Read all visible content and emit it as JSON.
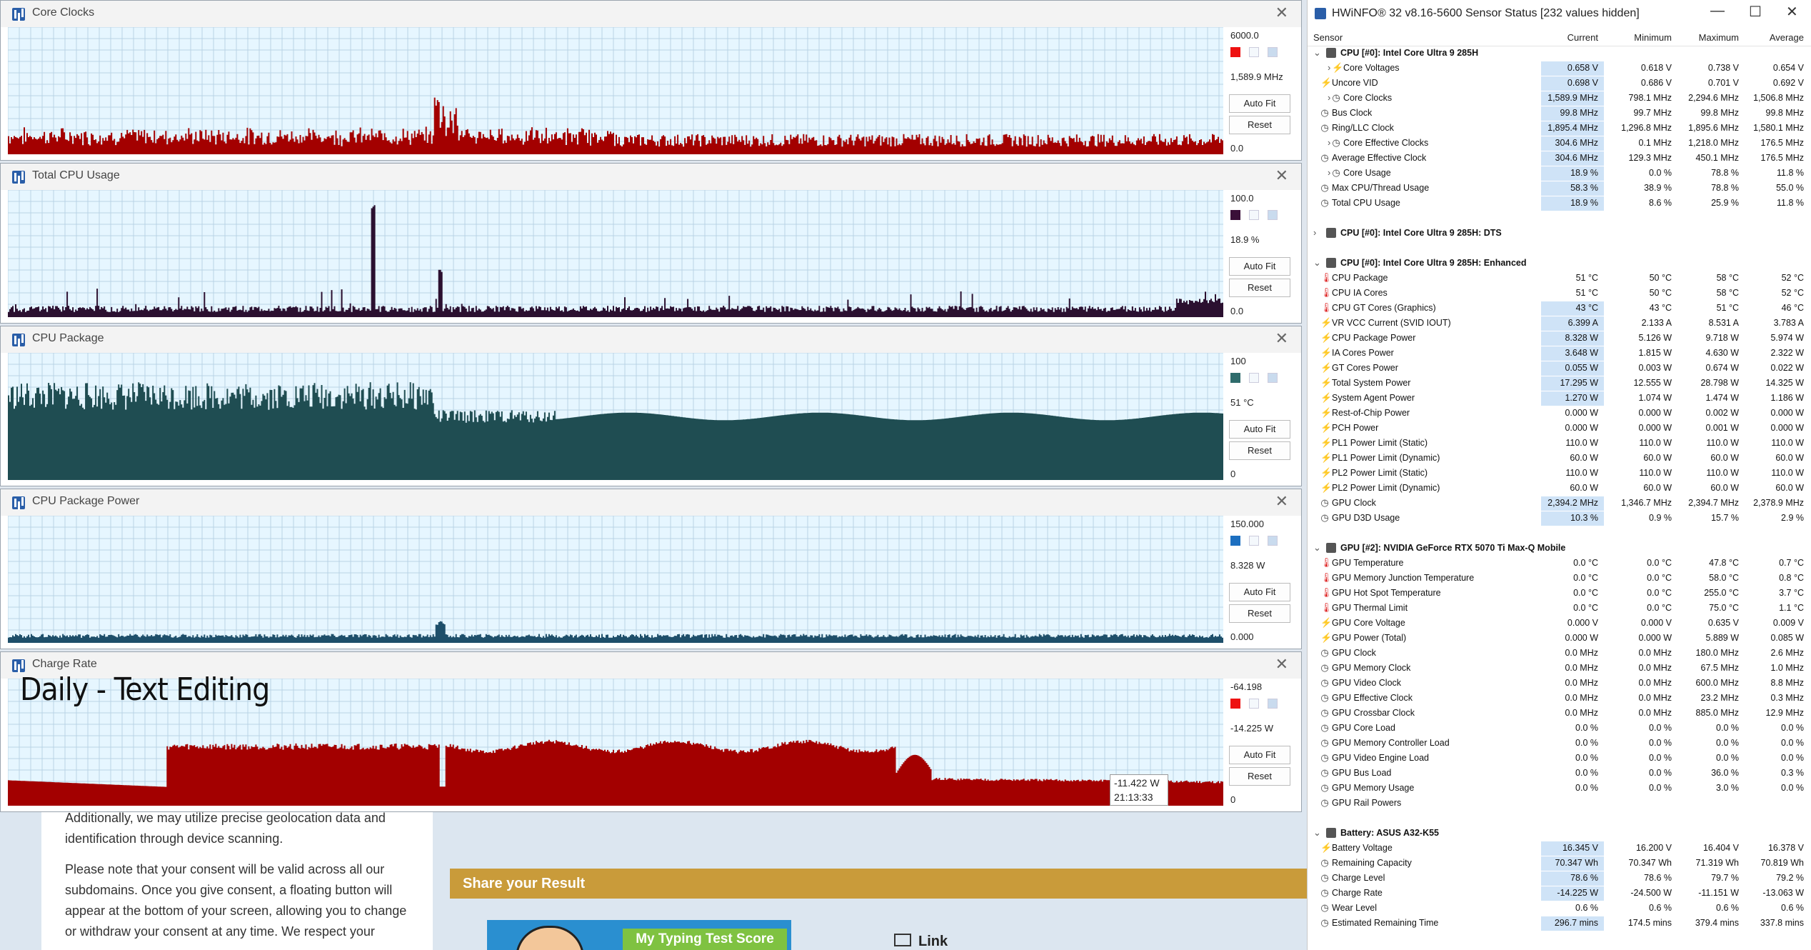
{
  "graphs": [
    {
      "title": "Core Clocks",
      "max": "6000.0",
      "current": "1,589.9 MHz",
      "min": "0.0",
      "color": "#a30000",
      "swatch": "#ee1111",
      "fill_fraction": 0.17,
      "spike_fraction": 0.56,
      "pattern": "clock"
    },
    {
      "title": "Total CPU Usage",
      "max": "100.0",
      "current": "18.9 %",
      "min": "0.0",
      "color": "#2b1030",
      "swatch": "#3a0f38",
      "fill_fraction": 0.06,
      "spike_fraction": 0.85,
      "pattern": "usage"
    },
    {
      "title": "CPU Package",
      "max": "100",
      "current": "51 °C",
      "min": "0",
      "color": "#1f4d52",
      "swatch": "#2f6c6c",
      "fill_fraction": 0.52,
      "spike_fraction": 0.8,
      "pattern": "temp"
    },
    {
      "title": "CPU Package Power",
      "max": "150.000",
      "current": "8.328 W",
      "min": "0.000",
      "color": "#1e4f6a",
      "swatch": "#1d6fc0",
      "fill_fraction": 0.05,
      "spike_fraction": 0.16,
      "pattern": "power"
    },
    {
      "title": "Charge Rate",
      "max": "-64.198",
      "current": "-14.225 W",
      "min": "0",
      "color": "#a30000",
      "swatch": "#ee1111",
      "fill_fraction": 0.24,
      "spike_fraction": 0.52,
      "pattern": "charge"
    }
  ],
  "buttons": {
    "autofit": "Auto Fit",
    "reset": "Reset"
  },
  "overlay_title": "Daily - Text Editing",
  "tooltip": {
    "value": "-11.422 W",
    "time": "21:13:33"
  },
  "background_page": {
    "p1": "Additionally, we may utilize precise geolocation data and identification through device scanning.",
    "p2": "Please note that your consent will be valid across all our subdomains. Once you give consent, a floating button will appear at the bottom of your screen, allowing you to change or withdraw your consent at any time. We respect your",
    "share_title": "Share your Result",
    "badge": "My Typing Test Score",
    "link": "Link"
  },
  "hwinfo": {
    "title": "HWiNFO® 32 v8.16-5600 Sensor Status [232 values hidden]",
    "columns": [
      "Sensor",
      "Current",
      "Minimum",
      "Maximum",
      "Average"
    ],
    "rows": [
      {
        "type": "hdr",
        "label": "CPU [#0]: Intel Core Ultra 9 285H",
        "exp": "⌄"
      },
      {
        "type": "row",
        "icon": "bolt",
        "sub": true,
        "exp": "›",
        "label": "Core Voltages",
        "cur": "0.658 V",
        "min": "0.618 V",
        "max": "0.738 V",
        "avg": "0.654 V",
        "hl": true
      },
      {
        "type": "row",
        "icon": "bolt",
        "label": "Uncore VID",
        "cur": "0.698 V",
        "min": "0.686 V",
        "max": "0.701 V",
        "avg": "0.692 V",
        "hl": true
      },
      {
        "type": "row",
        "icon": "clock",
        "sub": true,
        "exp": "›",
        "label": "Core Clocks",
        "cur": "1,589.9 MHz",
        "min": "798.1 MHz",
        "max": "2,294.6 MHz",
        "avg": "1,506.8 MHz",
        "hl": true
      },
      {
        "type": "row",
        "icon": "clock",
        "label": "Bus Clock",
        "cur": "99.8 MHz",
        "min": "99.7 MHz",
        "max": "99.8 MHz",
        "avg": "99.8 MHz",
        "hl": true
      },
      {
        "type": "row",
        "icon": "clock",
        "label": "Ring/LLC Clock",
        "cur": "1,895.4 MHz",
        "min": "1,296.8 MHz",
        "max": "1,895.6 MHz",
        "avg": "1,580.1 MHz",
        "hl": true
      },
      {
        "type": "row",
        "icon": "clock",
        "sub": true,
        "exp": "›",
        "label": "Core Effective Clocks",
        "cur": "304.6 MHz",
        "min": "0.1 MHz",
        "max": "1,218.0 MHz",
        "avg": "176.5 MHz",
        "hl": true
      },
      {
        "type": "row",
        "icon": "clock",
        "label": "Average Effective Clock",
        "cur": "304.6 MHz",
        "min": "129.3 MHz",
        "max": "450.1 MHz",
        "avg": "176.5 MHz",
        "hl": true
      },
      {
        "type": "row",
        "icon": "clock",
        "sub": true,
        "exp": "›",
        "label": "Core Usage",
        "cur": "18.9 %",
        "min": "0.0 %",
        "max": "78.8 %",
        "avg": "11.8 %",
        "hl": true
      },
      {
        "type": "row",
        "icon": "clock",
        "label": "Max CPU/Thread Usage",
        "cur": "58.3 %",
        "min": "38.9 %",
        "max": "78.8 %",
        "avg": "55.0 %",
        "hl": true
      },
      {
        "type": "row",
        "icon": "clock",
        "label": "Total CPU Usage",
        "cur": "18.9 %",
        "min": "8.6 %",
        "max": "25.9 %",
        "avg": "11.8 %",
        "hl": true
      },
      {
        "type": "gap"
      },
      {
        "type": "hdr",
        "label": "CPU [#0]: Intel Core Ultra 9 285H: DTS",
        "exp": "›"
      },
      {
        "type": "gap"
      },
      {
        "type": "hdr",
        "label": "CPU [#0]: Intel Core Ultra 9 285H: Enhanced",
        "exp": "⌄"
      },
      {
        "type": "row",
        "icon": "therm",
        "label": "CPU Package",
        "cur": "51 °C",
        "min": "50 °C",
        "max": "58 °C",
        "avg": "52 °C"
      },
      {
        "type": "row",
        "icon": "therm",
        "label": "CPU IA Cores",
        "cur": "51 °C",
        "min": "50 °C",
        "max": "58 °C",
        "avg": "52 °C"
      },
      {
        "type": "row",
        "icon": "therm",
        "label": "CPU GT Cores (Graphics)",
        "cur": "43 °C",
        "min": "43 °C",
        "max": "51 °C",
        "avg": "46 °C",
        "hl": true
      },
      {
        "type": "row",
        "icon": "bolt",
        "label": "VR VCC Current (SVID IOUT)",
        "cur": "6.399 A",
        "min": "2.133 A",
        "max": "8.531 A",
        "avg": "3.783 A",
        "hl": true
      },
      {
        "type": "row",
        "icon": "bolt",
        "label": "CPU Package Power",
        "cur": "8.328 W",
        "min": "5.126 W",
        "max": "9.718 W",
        "avg": "5.974 W",
        "hl": true
      },
      {
        "type": "row",
        "icon": "bolt",
        "label": "IA Cores Power",
        "cur": "3.648 W",
        "min": "1.815 W",
        "max": "4.630 W",
        "avg": "2.322 W",
        "hl": true
      },
      {
        "type": "row",
        "icon": "bolt",
        "label": "GT Cores Power",
        "cur": "0.055 W",
        "min": "0.003 W",
        "max": "0.674 W",
        "avg": "0.022 W",
        "hl": true
      },
      {
        "type": "row",
        "icon": "bolt",
        "label": "Total System Power",
        "cur": "17.295 W",
        "min": "12.555 W",
        "max": "28.798 W",
        "avg": "14.325 W",
        "hl": true
      },
      {
        "type": "row",
        "icon": "bolt",
        "label": "System Agent Power",
        "cur": "1.270 W",
        "min": "1.074 W",
        "max": "1.474 W",
        "avg": "1.186 W",
        "hl": true
      },
      {
        "type": "row",
        "icon": "bolt",
        "label": "Rest-of-Chip Power",
        "cur": "0.000 W",
        "min": "0.000 W",
        "max": "0.002 W",
        "avg": "0.000 W"
      },
      {
        "type": "row",
        "icon": "bolt",
        "label": "PCH Power",
        "cur": "0.000 W",
        "min": "0.000 W",
        "max": "0.001 W",
        "avg": "0.000 W"
      },
      {
        "type": "row",
        "icon": "bolt",
        "label": "PL1 Power Limit (Static)",
        "cur": "110.0 W",
        "min": "110.0 W",
        "max": "110.0 W",
        "avg": "110.0 W"
      },
      {
        "type": "row",
        "icon": "bolt",
        "label": "PL1 Power Limit (Dynamic)",
        "cur": "60.0 W",
        "min": "60.0 W",
        "max": "60.0 W",
        "avg": "60.0 W"
      },
      {
        "type": "row",
        "icon": "bolt",
        "label": "PL2 Power Limit (Static)",
        "cur": "110.0 W",
        "min": "110.0 W",
        "max": "110.0 W",
        "avg": "110.0 W"
      },
      {
        "type": "row",
        "icon": "bolt",
        "label": "PL2 Power Limit (Dynamic)",
        "cur": "60.0 W",
        "min": "60.0 W",
        "max": "60.0 W",
        "avg": "60.0 W"
      },
      {
        "type": "row",
        "icon": "clock",
        "label": "GPU Clock",
        "cur": "2,394.2 MHz",
        "min": "1,346.7 MHz",
        "max": "2,394.7 MHz",
        "avg": "2,378.9 MHz",
        "hl": true
      },
      {
        "type": "row",
        "icon": "clock",
        "label": "GPU D3D Usage",
        "cur": "10.3 %",
        "min": "0.9 %",
        "max": "15.7 %",
        "avg": "2.9 %",
        "hl": true
      },
      {
        "type": "gap"
      },
      {
        "type": "hdr",
        "label": "GPU [#2]: NVIDIA  GeForce RTX 5070 Ti Max-Q Mobile",
        "exp": "⌄"
      },
      {
        "type": "row",
        "icon": "therm",
        "label": "GPU Temperature",
        "cur": "0.0 °C",
        "min": "0.0 °C",
        "max": "47.8 °C",
        "avg": "0.7 °C"
      },
      {
        "type": "row",
        "icon": "therm",
        "label": "GPU Memory Junction Temperature",
        "cur": "0.0 °C",
        "min": "0.0 °C",
        "max": "58.0 °C",
        "avg": "0.8 °C"
      },
      {
        "type": "row",
        "icon": "therm",
        "label": "GPU Hot Spot Temperature",
        "cur": "0.0 °C",
        "min": "0.0 °C",
        "max": "255.0 °C",
        "avg": "3.7 °C"
      },
      {
        "type": "row",
        "icon": "therm",
        "label": "GPU Thermal Limit",
        "cur": "0.0 °C",
        "min": "0.0 °C",
        "max": "75.0 °C",
        "avg": "1.1 °C"
      },
      {
        "type": "row",
        "icon": "bolt",
        "label": "GPU Core Voltage",
        "cur": "0.000 V",
        "min": "0.000 V",
        "max": "0.635 V",
        "avg": "0.009 V"
      },
      {
        "type": "row",
        "icon": "bolt",
        "label": "GPU Power (Total)",
        "cur": "0.000 W",
        "min": "0.000 W",
        "max": "5.889 W",
        "avg": "0.085 W"
      },
      {
        "type": "row",
        "icon": "clock",
        "label": "GPU Clock",
        "cur": "0.0 MHz",
        "min": "0.0 MHz",
        "max": "180.0 MHz",
        "avg": "2.6 MHz"
      },
      {
        "type": "row",
        "icon": "clock",
        "label": "GPU Memory Clock",
        "cur": "0.0 MHz",
        "min": "0.0 MHz",
        "max": "67.5 MHz",
        "avg": "1.0 MHz"
      },
      {
        "type": "row",
        "icon": "clock",
        "label": "GPU Video Clock",
        "cur": "0.0 MHz",
        "min": "0.0 MHz",
        "max": "600.0 MHz",
        "avg": "8.8 MHz"
      },
      {
        "type": "row",
        "icon": "clock",
        "label": "GPU Effective Clock",
        "cur": "0.0 MHz",
        "min": "0.0 MHz",
        "max": "23.2 MHz",
        "avg": "0.3 MHz"
      },
      {
        "type": "row",
        "icon": "clock",
        "label": "GPU Crossbar Clock",
        "cur": "0.0 MHz",
        "min": "0.0 MHz",
        "max": "885.0 MHz",
        "avg": "12.9 MHz"
      },
      {
        "type": "row",
        "icon": "clock",
        "label": "GPU Core Load",
        "cur": "0.0 %",
        "min": "0.0 %",
        "max": "0.0 %",
        "avg": "0.0 %"
      },
      {
        "type": "row",
        "icon": "clock",
        "label": "GPU Memory Controller Load",
        "cur": "0.0 %",
        "min": "0.0 %",
        "max": "0.0 %",
        "avg": "0.0 %"
      },
      {
        "type": "row",
        "icon": "clock",
        "label": "GPU Video Engine Load",
        "cur": "0.0 %",
        "min": "0.0 %",
        "max": "0.0 %",
        "avg": "0.0 %"
      },
      {
        "type": "row",
        "icon": "clock",
        "label": "GPU Bus Load",
        "cur": "0.0 %",
        "min": "0.0 %",
        "max": "36.0 %",
        "avg": "0.3 %"
      },
      {
        "type": "row",
        "icon": "clock",
        "label": "GPU Memory Usage",
        "cur": "0.0 %",
        "min": "0.0 %",
        "max": "3.0 %",
        "avg": "0.0 %"
      },
      {
        "type": "row",
        "icon": "clock",
        "label": "GPU Rail Powers",
        "cur": "",
        "min": "",
        "max": "",
        "avg": ""
      },
      {
        "type": "gap"
      },
      {
        "type": "hdr",
        "label": "Battery: ASUS  A32-K55",
        "exp": "⌄"
      },
      {
        "type": "row",
        "icon": "bolt",
        "label": "Battery Voltage",
        "cur": "16.345 V",
        "min": "16.200 V",
        "max": "16.404 V",
        "avg": "16.378 V",
        "hl": true
      },
      {
        "type": "row",
        "icon": "clock",
        "label": "Remaining Capacity",
        "cur": "70.347 Wh",
        "min": "70.347 Wh",
        "max": "71.319 Wh",
        "avg": "70.819 Wh",
        "hl": true
      },
      {
        "type": "row",
        "icon": "clock",
        "label": "Charge Level",
        "cur": "78.6 %",
        "min": "78.6 %",
        "max": "79.7 %",
        "avg": "79.2 %",
        "hl": true
      },
      {
        "type": "row",
        "icon": "clock",
        "label": "Charge Rate",
        "cur": "-14.225 W",
        "min": "-24.500 W",
        "max": "-11.151 W",
        "avg": "-13.063 W",
        "hl": true
      },
      {
        "type": "row",
        "icon": "clock",
        "label": "Wear Level",
        "cur": "0.6 %",
        "min": "0.6 %",
        "max": "0.6 %",
        "avg": "0.6 %"
      },
      {
        "type": "row",
        "icon": "clock",
        "label": "Estimated Remaining Time",
        "cur": "296.7 mins",
        "min": "174.5 mins",
        "max": "379.4 mins",
        "avg": "337.8 mins",
        "hl": true
      }
    ]
  }
}
